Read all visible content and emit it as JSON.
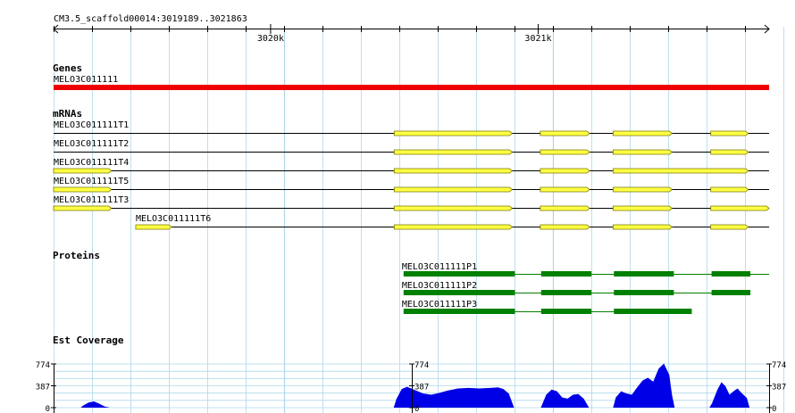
{
  "region": "CM3.5_scaffold00014:3019189..3021863",
  "ruler": {
    "start": 3019189,
    "end": 3021863,
    "ticks": [
      {
        "pos": 3020000,
        "label": "3020k"
      },
      {
        "pos": 3021000,
        "label": "3021k"
      }
    ]
  },
  "sections": {
    "genes": "Genes",
    "mrnas": "mRNAs",
    "proteins": "Proteins",
    "est": "Est Coverage"
  },
  "genes": [
    {
      "name": "MELO3C011111",
      "start": 3019189,
      "end": 3021863,
      "color": "#ee0000"
    }
  ],
  "mrnas": [
    {
      "name": "MELO3C011111T1",
      "start": 3019189,
      "end": 3021863,
      "exons": [
        [
          3020462,
          3020903
        ],
        [
          3021008,
          3021192
        ],
        [
          3021280,
          3021500
        ],
        [
          3021645,
          3021785
        ]
      ]
    },
    {
      "name": "MELO3C011111T2",
      "start": 3019189,
      "end": 3021863,
      "exons": [
        [
          3020462,
          3020903
        ],
        [
          3021008,
          3021192
        ],
        [
          3021280,
          3021500
        ],
        [
          3021645,
          3021785
        ]
      ]
    },
    {
      "name": "MELO3C011111T4",
      "start": 3019189,
      "end": 3021863,
      "exons": [
        [
          3019189,
          3019405
        ],
        [
          3020462,
          3020903
        ],
        [
          3021008,
          3021192
        ],
        [
          3021280,
          3021785
        ]
      ]
    },
    {
      "name": "MELO3C011111T5",
      "start": 3019189,
      "end": 3021863,
      "exons": [
        [
          3019189,
          3019405
        ],
        [
          3020462,
          3020903
        ],
        [
          3021008,
          3021192
        ],
        [
          3021280,
          3021500
        ],
        [
          3021645,
          3021785
        ]
      ]
    },
    {
      "name": "MELO3C011111T3",
      "start": 3019189,
      "end": 3021863,
      "exons": [
        [
          3019189,
          3019405
        ],
        [
          3020462,
          3020903
        ],
        [
          3021008,
          3021192
        ],
        [
          3021280,
          3021500
        ],
        [
          3021645,
          3021863
        ]
      ]
    },
    {
      "name": "MELO3C011111T6",
      "start": 3019496,
      "end": 3021863,
      "exons": [
        [
          3019496,
          3019630
        ],
        [
          3020462,
          3020903
        ],
        [
          3021008,
          3021192
        ],
        [
          3021280,
          3021500
        ],
        [
          3021645,
          3021785
        ]
      ]
    }
  ],
  "proteins": [
    {
      "name": "MELO3C011111P1",
      "start": 3020497,
      "end": 3021863,
      "blocks": [
        [
          3020497,
          3020913
        ],
        [
          3021011,
          3021199
        ],
        [
          3021283,
          3021507
        ],
        [
          3021648,
          3021793
        ]
      ]
    },
    {
      "name": "MELO3C011111P2",
      "start": 3020497,
      "end": 3021793,
      "blocks": [
        [
          3020497,
          3020913
        ],
        [
          3021011,
          3021199
        ],
        [
          3021283,
          3021507
        ],
        [
          3021648,
          3021793
        ]
      ]
    },
    {
      "name": "MELO3C011111P3",
      "start": 3020497,
      "end": 3021574,
      "blocks": [
        [
          3020497,
          3020913
        ],
        [
          3021011,
          3021199
        ],
        [
          3021283,
          3021574
        ]
      ]
    }
  ],
  "est_axis": {
    "ticks": [
      "774",
      "387",
      "0"
    ],
    "max": 774
  },
  "est_coverage": [
    [
      3019189,
      0
    ],
    [
      3019290,
      0
    ],
    [
      3019300,
      40
    ],
    [
      3019320,
      90
    ],
    [
      3019340,
      110
    ],
    [
      3019360,
      70
    ],
    [
      3019380,
      20
    ],
    [
      3019400,
      0
    ],
    [
      3020460,
      0
    ],
    [
      3020470,
      150
    ],
    [
      3020490,
      330
    ],
    [
      3020510,
      370
    ],
    [
      3020530,
      330
    ],
    [
      3020550,
      290
    ],
    [
      3020570,
      250
    ],
    [
      3020600,
      230
    ],
    [
      3020630,
      260
    ],
    [
      3020660,
      300
    ],
    [
      3020700,
      340
    ],
    [
      3020740,
      350
    ],
    [
      3020780,
      340
    ],
    [
      3020820,
      350
    ],
    [
      3020850,
      360
    ],
    [
      3020870,
      330
    ],
    [
      3020890,
      250
    ],
    [
      3020910,
      0
    ],
    [
      3021010,
      0
    ],
    [
      3021030,
      230
    ],
    [
      3021050,
      320
    ],
    [
      3021070,
      290
    ],
    [
      3021090,
      180
    ],
    [
      3021110,
      160
    ],
    [
      3021130,
      230
    ],
    [
      3021150,
      240
    ],
    [
      3021170,
      160
    ],
    [
      3021190,
      0
    ],
    [
      3021280,
      0
    ],
    [
      3021290,
      180
    ],
    [
      3021310,
      290
    ],
    [
      3021330,
      250
    ],
    [
      3021350,
      230
    ],
    [
      3021370,
      360
    ],
    [
      3021390,
      480
    ],
    [
      3021410,
      530
    ],
    [
      3021430,
      460
    ],
    [
      3021450,
      690
    ],
    [
      3021470,
      780
    ],
    [
      3021490,
      580
    ],
    [
      3021500,
      230
    ],
    [
      3021510,
      0
    ],
    [
      3021640,
      0
    ],
    [
      3021650,
      80
    ],
    [
      3021670,
      320
    ],
    [
      3021685,
      450
    ],
    [
      3021700,
      380
    ],
    [
      3021715,
      230
    ],
    [
      3021730,
      290
    ],
    [
      3021745,
      340
    ],
    [
      3021760,
      260
    ],
    [
      3021780,
      170
    ],
    [
      3021790,
      0
    ],
    [
      3021863,
      0
    ]
  ],
  "colors": {
    "grid": "#add8ea",
    "exon_fill": "#ffff44",
    "exon_stroke": "#777700",
    "protein": "#008000",
    "coverage": "#0000e6",
    "gene": "#ee0000"
  }
}
